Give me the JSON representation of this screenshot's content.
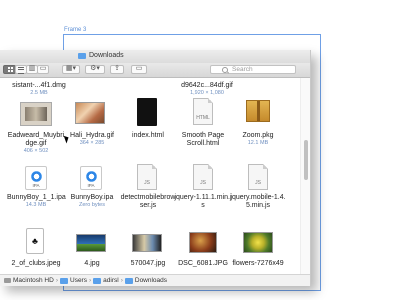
{
  "frame": {
    "label": "Frame 3"
  },
  "window": {
    "title": "Downloads"
  },
  "toolbar": {
    "view_icons": [
      "icon-view-icon",
      "list-view-icon",
      "column-view-icon",
      "cover-flow-icon"
    ],
    "arrange_icon": "arrange-icon",
    "action_icon": "gear-icon",
    "share_icon": "share-icon",
    "tags_icon": "tag-icon",
    "search_placeholder": "Search"
  },
  "row0": [
    {
      "name": "sistant-...4f1.dmg",
      "sub": "2.5 MB"
    },
    {
      "name": "",
      "sub": ""
    },
    {
      "name": "",
      "sub": ""
    },
    {
      "name": "d9642c...84df.gif",
      "sub": "1,920 × 1,080"
    },
    {
      "name": "",
      "sub": ""
    }
  ],
  "row1": [
    {
      "name": "Eadweard_Muybridge.gif",
      "name2": "dge.gif",
      "name1": "Eadweard_Muybri",
      "sub": "406 × 502"
    },
    {
      "name": "Hali_Hydra.gif",
      "sub": "364 × 285"
    },
    {
      "name": "index.html",
      "sub": ""
    },
    {
      "name1": "Smooth Page",
      "name2": "Scroll.html",
      "sub": ""
    },
    {
      "name": "Zoom.pkg",
      "sub": "12.1 MB"
    }
  ],
  "row2": [
    {
      "name": "BunnyBoy_1_1.ipa",
      "sub": "14.3 MB",
      "badge": "IPA"
    },
    {
      "name": "BunnyBoy.ipa",
      "sub": "Zero bytes",
      "badge": "IPA"
    },
    {
      "name1": "detectmobilebrow",
      "name2": "ser.js",
      "sub": "",
      "ext": "JS"
    },
    {
      "name1": "jquery-1.11.1.min.j",
      "name2": "s",
      "sub": "",
      "ext": "JS"
    },
    {
      "name1": "jquery.mobile-1.4.",
      "name2": "5.min.js",
      "sub": "",
      "ext": "JS"
    }
  ],
  "row3": [
    {
      "name": "2_of_clubs.jpeg",
      "sub": ""
    },
    {
      "name": "4.jpg",
      "sub": ""
    },
    {
      "name": "570047.jpg",
      "sub": ""
    },
    {
      "name": "DSC_6081.JPG",
      "sub": ""
    },
    {
      "name": "flowers-7276x49",
      "sub": ""
    }
  ],
  "pathbar": [
    "Macintosh HD",
    "Users",
    "adirsl",
    "Downloads"
  ],
  "html_ext": "HTML",
  "pkg_ext": "PKG"
}
